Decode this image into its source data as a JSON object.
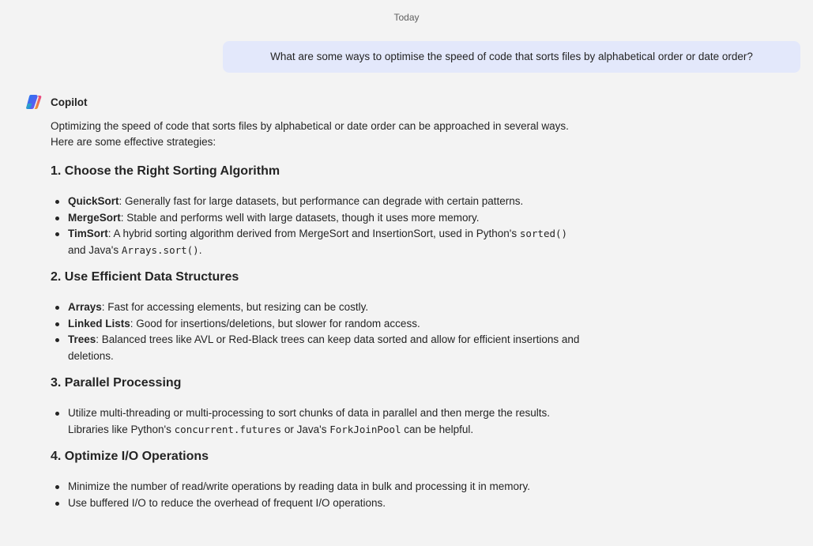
{
  "chat": {
    "date_separator": "Today",
    "user_message": "What are some ways to optimise the speed of code that sorts files by alphabetical order or date order?",
    "assistant_name": "Copilot",
    "assistant_logo_icon": "copilot-logo-icon"
  },
  "answer": {
    "intro_line1": "Optimizing the speed of code that sorts files by alphabetical or date order can be approached in several ways.",
    "intro_line2": "Here are some effective strategies:",
    "sections": [
      {
        "num": "1.",
        "title": "Choose the Right Sorting Algorithm",
        "items": [
          {
            "term": "QuickSort",
            "text": ": Generally fast for large datasets, but performance can degrade with certain patterns."
          },
          {
            "term": "MergeSort",
            "text": ": Stable and performs well with large datasets, though it uses more memory."
          },
          {
            "term": "TimSort",
            "text_a": ": A hybrid sorting algorithm derived from MergeSort and InsertionSort, used in Python's ",
            "code_a": "sorted()",
            "text_b": "and Java's ",
            "code_b": "Arrays.sort()",
            "text_c": "."
          }
        ]
      },
      {
        "num": "2.",
        "title": "Use Efficient Data Structures",
        "items": [
          {
            "term": "Arrays",
            "text": ": Fast for accessing elements, but resizing can be costly."
          },
          {
            "term": "Linked Lists",
            "text": ": Good for insertions/deletions, but slower for random access."
          },
          {
            "term": "Trees",
            "text_a": ": Balanced trees like AVL or Red-Black trees can keep data sorted and allow for efficient insertions and",
            "text_b": "deletions."
          }
        ]
      },
      {
        "num": "3.",
        "title": "Parallel Processing",
        "items": [
          {
            "text_a": "Utilize multi-threading or multi-processing to sort chunks of data in parallel and then merge the results.",
            "text_b": "Libraries like Python's ",
            "code_a": "concurrent.futures",
            "text_c": " or Java's ",
            "code_b": "ForkJoinPool",
            "text_d": " can be helpful."
          }
        ]
      },
      {
        "num": "4.",
        "title": "Optimize I/O Operations",
        "items": [
          {
            "text": "Minimize the number of read/write operations by reading data in bulk and processing it in memory."
          },
          {
            "text": "Use buffered I/O to reduce the overhead of frequent I/O operations."
          }
        ]
      }
    ]
  }
}
